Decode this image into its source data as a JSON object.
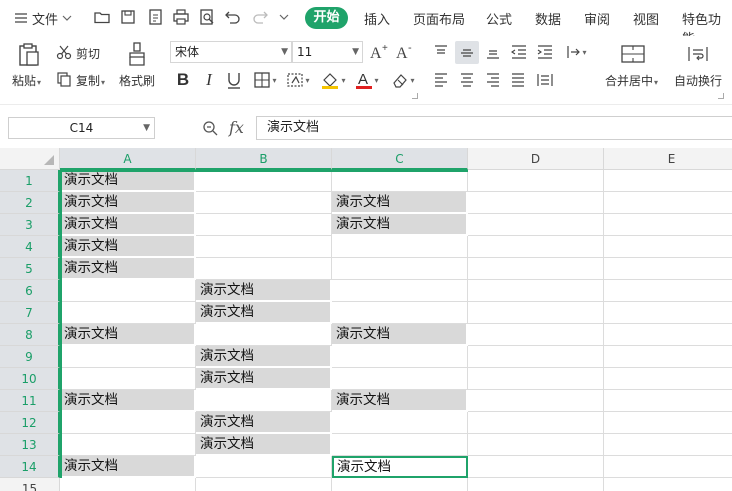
{
  "menubar": {
    "file_label": "文件",
    "tabs": [
      "开始",
      "插入",
      "页面布局",
      "公式",
      "数据",
      "审阅",
      "视图",
      "特色功能"
    ],
    "active_tab": "开始",
    "quick_icons": [
      "open-folder-icon",
      "save-icon",
      "export-pdf-icon",
      "print-icon",
      "print-preview-icon",
      "undo-icon",
      "redo-icon",
      "more-icon"
    ]
  },
  "ribbon": {
    "paste_label": "粘贴",
    "cut_label": "剪切",
    "copy_label": "复制",
    "format_painter_label": "格式刷",
    "font_name": "宋体",
    "font_size": "11",
    "merge_center_label": "合并居中",
    "wrap_text_label": "自动换行",
    "font_color": "#e02020",
    "fill_color": "#f5c400"
  },
  "formula_bar": {
    "name_box": "C14",
    "fx_label": "fx",
    "formula_value": "演示文档"
  },
  "sheet": {
    "columns": [
      "A",
      "B",
      "C",
      "D",
      "E"
    ],
    "selected_columns": [
      "A",
      "B",
      "C"
    ],
    "rows": [
      "1",
      "2",
      "3",
      "4",
      "5",
      "6",
      "7",
      "8",
      "9",
      "10",
      "11",
      "12",
      "13",
      "14",
      "15"
    ],
    "active_cell": "C14",
    "fill_color": "#d9d9d9",
    "accent_color": "#1fa36a",
    "cells": [
      {
        "ref": "A1",
        "value": "演示文档"
      },
      {
        "ref": "A2",
        "value": "演示文档"
      },
      {
        "ref": "C2",
        "value": "演示文档"
      },
      {
        "ref": "A3",
        "value": "演示文档"
      },
      {
        "ref": "C3",
        "value": "演示文档"
      },
      {
        "ref": "A4",
        "value": "演示文档"
      },
      {
        "ref": "A5",
        "value": "演示文档"
      },
      {
        "ref": "B6",
        "value": "演示文档"
      },
      {
        "ref": "B7",
        "value": "演示文档"
      },
      {
        "ref": "A8",
        "value": "演示文档"
      },
      {
        "ref": "C8",
        "value": "演示文档"
      },
      {
        "ref": "B9",
        "value": "演示文档"
      },
      {
        "ref": "B10",
        "value": "演示文档"
      },
      {
        "ref": "A11",
        "value": "演示文档"
      },
      {
        "ref": "C11",
        "value": "演示文档"
      },
      {
        "ref": "B12",
        "value": "演示文档"
      },
      {
        "ref": "B13",
        "value": "演示文档"
      },
      {
        "ref": "A14",
        "value": "演示文档"
      },
      {
        "ref": "C14",
        "value": "演示文档"
      }
    ]
  }
}
